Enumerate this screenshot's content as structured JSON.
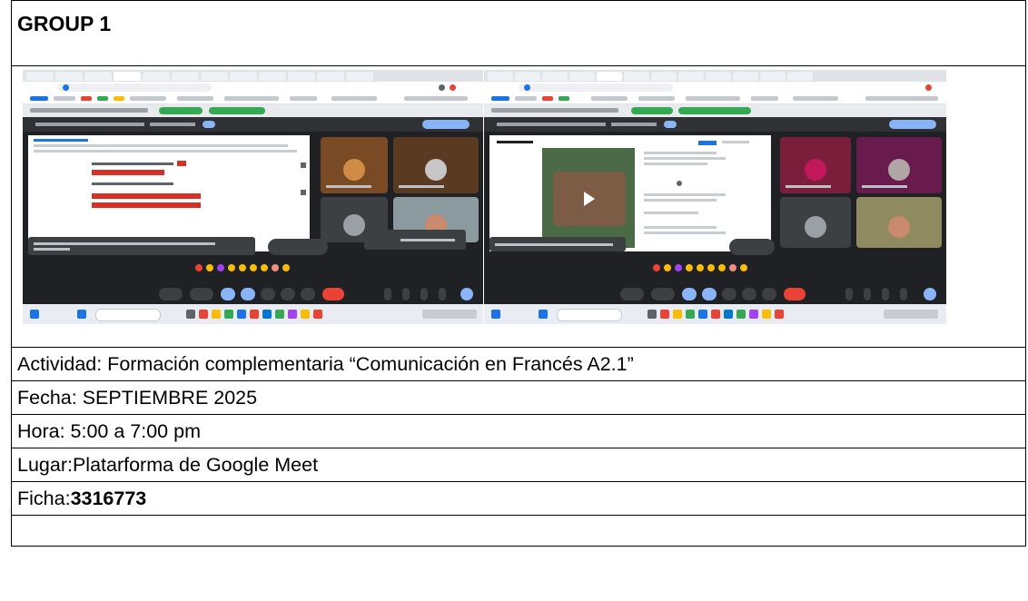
{
  "header": {
    "title": "GROUP 1"
  },
  "screenshot_strip": {
    "description_icon": "meet-screenshot-icon"
  },
  "fields": {
    "actividad": "Actividad: Formación complementaria “Comunicación en Francés A2.1”",
    "fecha": "Fecha: SEPTIEMBRE 2025",
    "hora": "Hora: 5:00 a 7:00 pm",
    "lugar": "Lugar:Platarforma de Google Meet",
    "ficha_label": "Ficha:",
    "ficha_value": "3316773"
  }
}
